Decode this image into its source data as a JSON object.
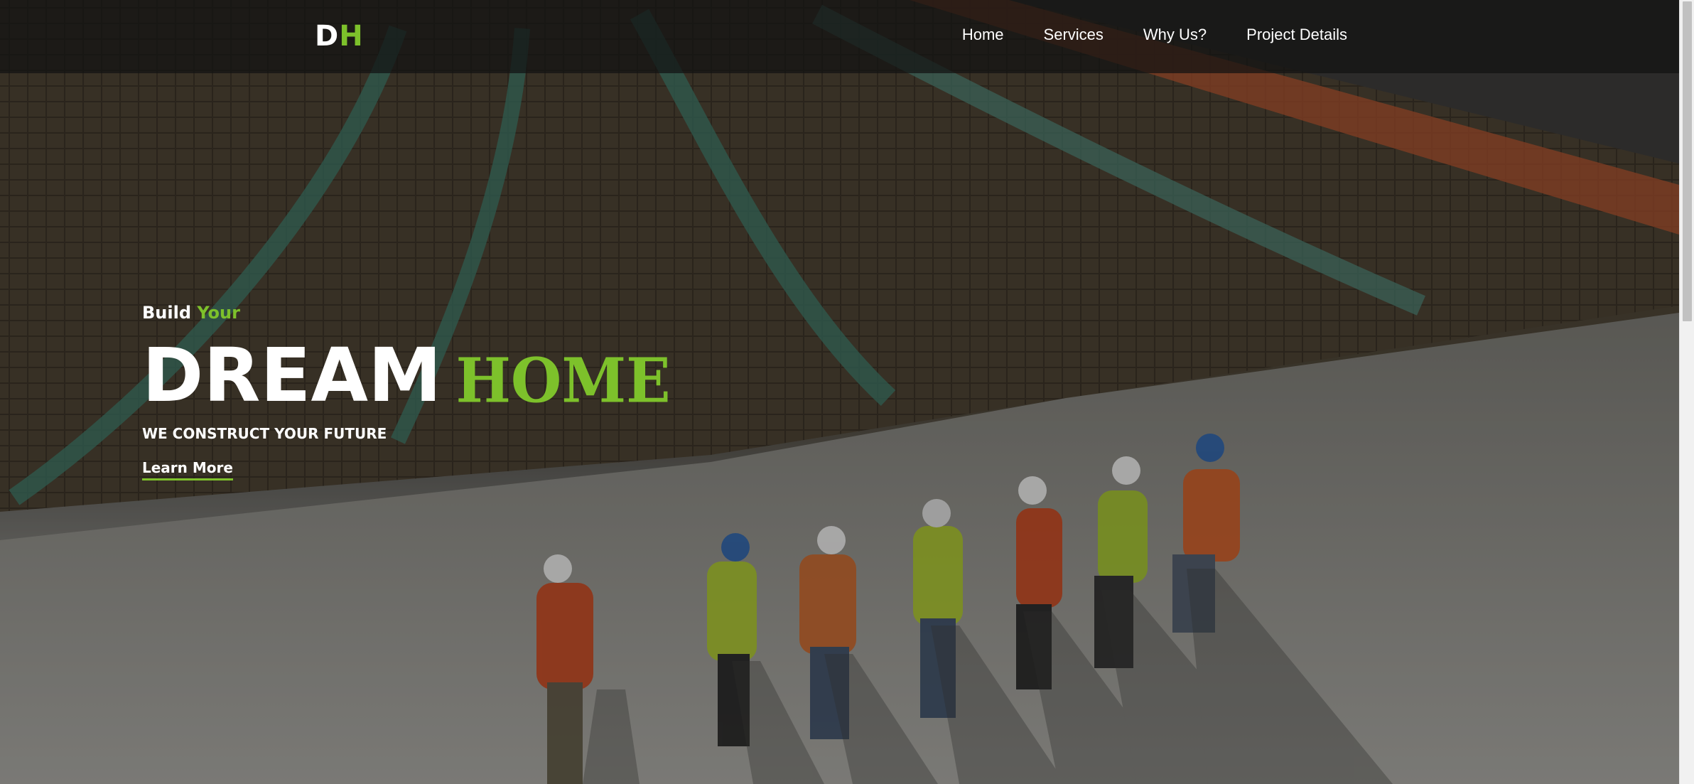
{
  "navbar": {
    "logo": {
      "first": "D",
      "second": "H"
    },
    "links": [
      {
        "label": "Home"
      },
      {
        "label": "Services"
      },
      {
        "label": "Why Us?"
      },
      {
        "label": "Project Details"
      }
    ]
  },
  "hero": {
    "eyebrow": {
      "lead": "Build",
      "accent": "Your"
    },
    "headline": {
      "main": "DREAM",
      "accent": "HOME"
    },
    "tagline": "WE CONSTRUCT YOUR FUTURE",
    "cta_label": "Learn More",
    "background_description_icon": "construction-site-photo"
  },
  "colors": {
    "accent": "#7dc12b",
    "text": "#ffffff",
    "nav_background": "#121212"
  }
}
